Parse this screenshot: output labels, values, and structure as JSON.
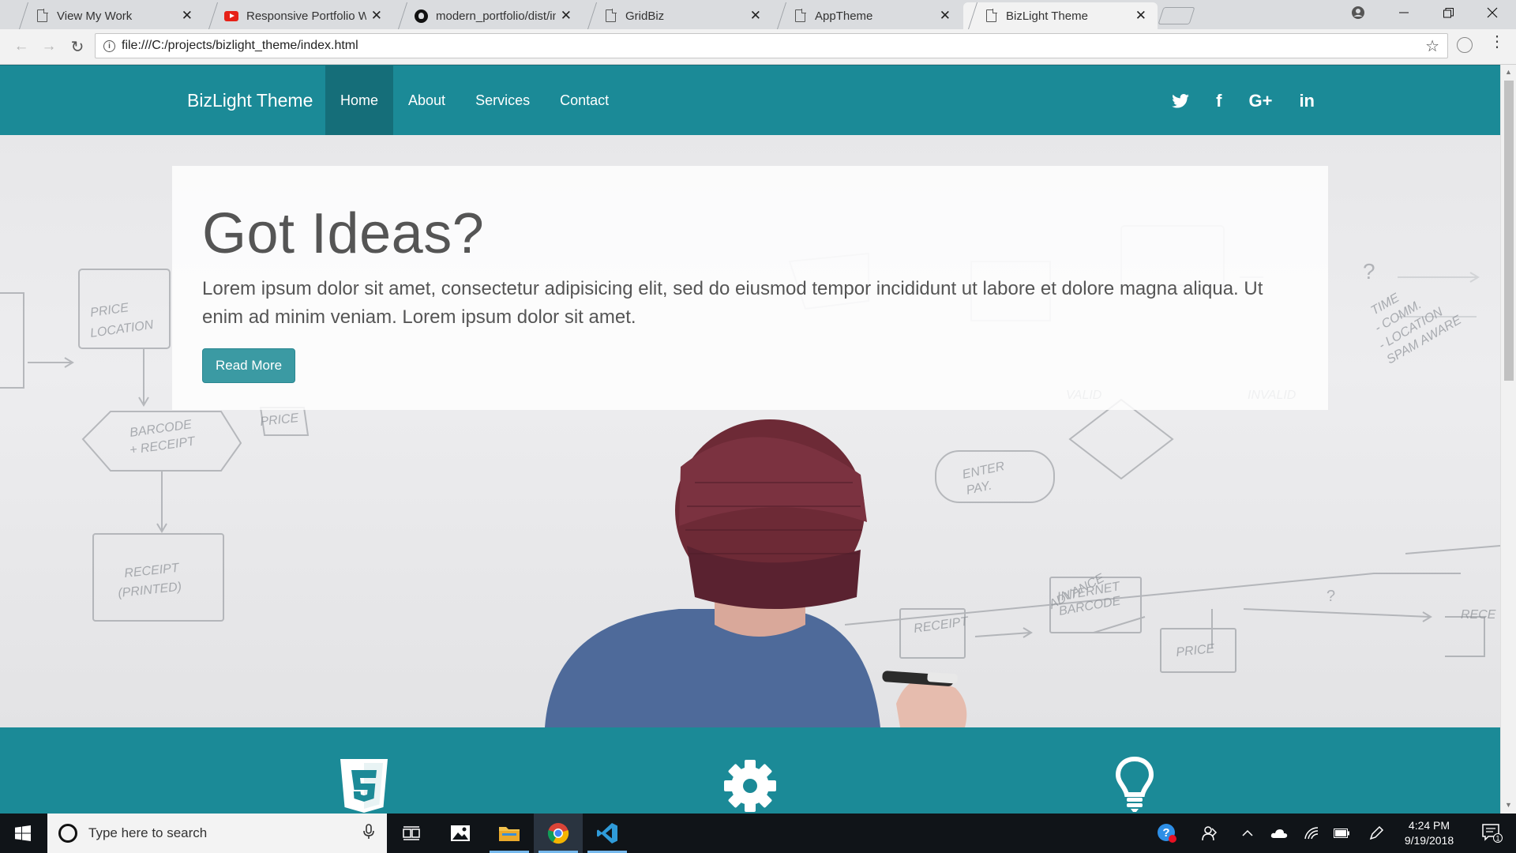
{
  "browser": {
    "tabs": [
      {
        "title": "View My Work",
        "favicon": "page-icon"
      },
      {
        "title": "Responsive Portfolio Web",
        "favicon": "youtube-icon"
      },
      {
        "title": "modern_portfolio/dist/im",
        "favicon": "github-icon"
      },
      {
        "title": "GridBiz",
        "favicon": "page-icon"
      },
      {
        "title": "AppTheme",
        "favicon": "page-icon"
      },
      {
        "title": "BizLight Theme",
        "favicon": "page-icon",
        "active": true
      }
    ],
    "close_glyph": "✕",
    "url": "file:///C:/projects/bizlight_theme/index.html"
  },
  "site": {
    "brand": "BizLight Theme",
    "nav": [
      "Home",
      "About",
      "Services",
      "Contact"
    ],
    "active_nav": "Home",
    "social": [
      "twitter-icon",
      "facebook-icon",
      "google-plus-icon",
      "linkedin-icon"
    ],
    "social_text": {
      "facebook": "f",
      "google": "G+",
      "linkedin": "in"
    },
    "hero": {
      "heading": "Got Ideas?",
      "text": "Lorem ipsum dolor sit amet, consectetur adipisicing elit, sed do eiusmod tempor incididunt ut labore et dolore magna aliqua. Ut enim ad minim veniam. Lorem ipsum dolor sit amet.",
      "button": "Read More"
    },
    "features": [
      "html5-icon",
      "gear-icon",
      "lightbulb-icon"
    ],
    "colors": {
      "primary": "#1b8a97",
      "active_nav": "#156e79",
      "button": "#3b9aa3",
      "text": "#555555"
    }
  },
  "taskbar": {
    "search_placeholder": "Type here to search",
    "time": "4:24 PM",
    "date": "9/19/2018",
    "notification_count": "1",
    "apps": [
      "task-view-icon",
      "photos-icon",
      "file-explorer-icon",
      "chrome-icon",
      "vscode-icon"
    ]
  }
}
